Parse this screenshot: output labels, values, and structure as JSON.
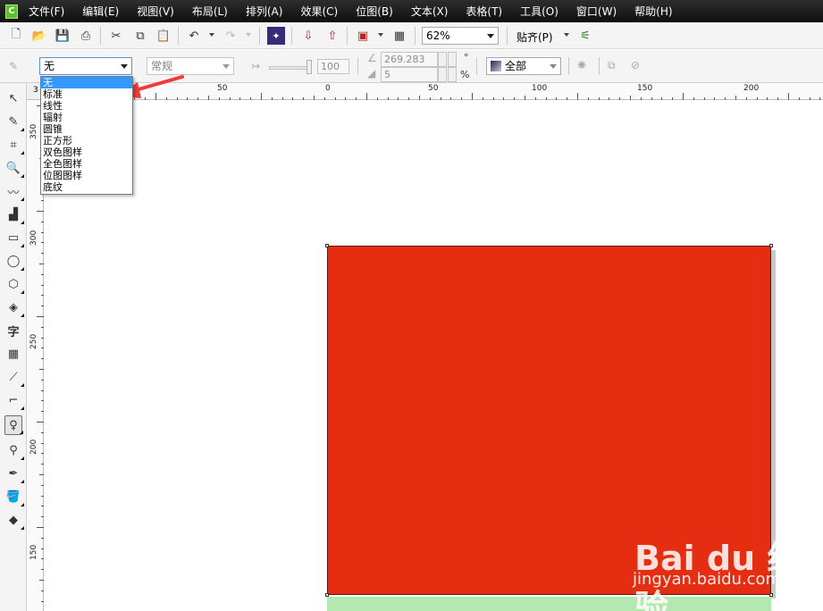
{
  "menubar": {
    "items": [
      "文件(F)",
      "编辑(E)",
      "视图(V)",
      "布局(L)",
      "排列(A)",
      "效果(C)",
      "位图(B)",
      "文本(X)",
      "表格(T)",
      "工具(O)",
      "窗口(W)",
      "帮助(H)"
    ]
  },
  "toolbar": {
    "zoom": "62%",
    "snap": "贴齐(P)"
  },
  "propertybar": {
    "fill_type": "无",
    "fill_mode": "常规",
    "transparency": "100",
    "angle": "269.283",
    "angle_unit": "°",
    "edge": "5",
    "edge_unit": "%",
    "apply_to": "全部"
  },
  "dropdown": {
    "items": [
      "无",
      "标准",
      "线性",
      "辐射",
      "圆锥",
      "正方形",
      "双色图样",
      "全色图样",
      "位图图样",
      "底纹"
    ],
    "selected_index": 0
  },
  "ruler": {
    "h_labels": [
      "50",
      "0",
      "50",
      "100",
      "150",
      "200"
    ],
    "v_labels": [
      "350",
      "300",
      "250",
      "200",
      "150"
    ],
    "corner_label": "3"
  },
  "canvas": {
    "rect_color": "#e52d11",
    "bottom_color": "#b3e8b0"
  },
  "watermark": {
    "main": "Bai du 经验",
    "sub": "jingyan.baidu.com"
  }
}
